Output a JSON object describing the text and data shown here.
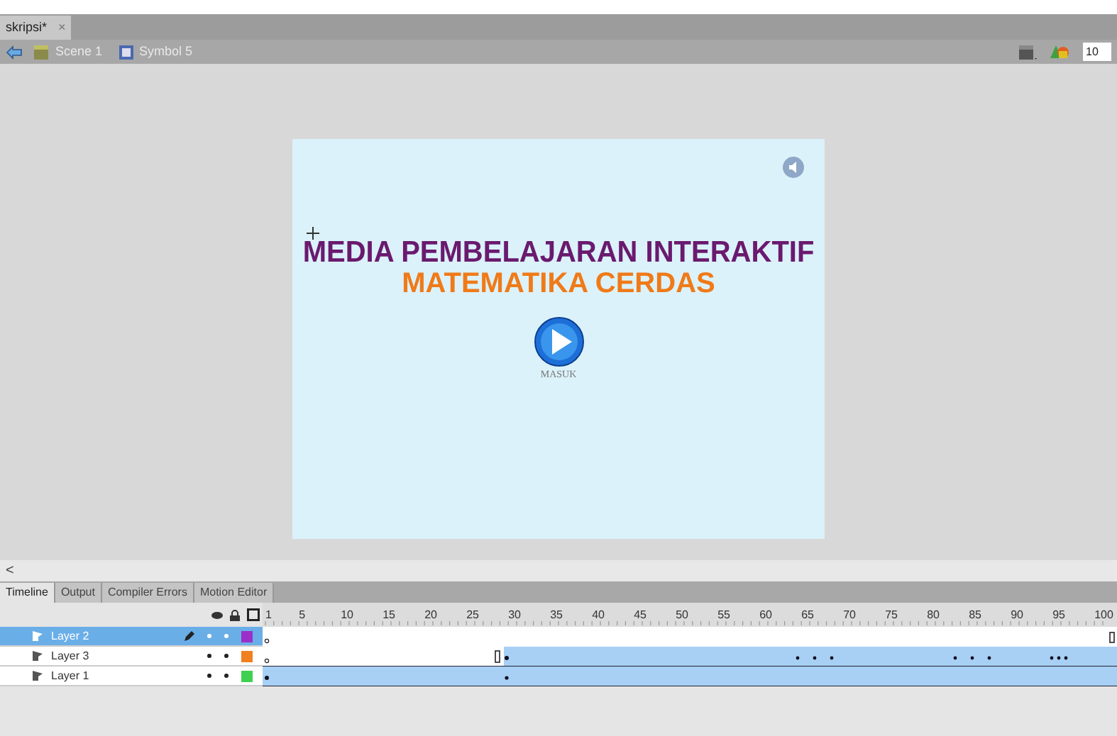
{
  "document_tab": {
    "label": "skripsi*",
    "close": "×"
  },
  "breadcrumb": {
    "items": [
      "Scene 1",
      "Symbol 5"
    ],
    "zoom": "10"
  },
  "stage": {
    "title": "MEDIA PEMBELAJARAN INTERAKTIF",
    "subtitle": "MATEMATIKA CERDAS",
    "button_label": "MASUK"
  },
  "scroll_arrow": "<",
  "panel_tabs": [
    {
      "label": "Timeline",
      "selected": true
    },
    {
      "label": "Output",
      "selected": false
    },
    {
      "label": "Compiler Errors",
      "selected": false
    },
    {
      "label": "Motion Editor",
      "selected": false
    }
  ],
  "timeline": {
    "ruler": [
      "1",
      "5",
      "10",
      "15",
      "20",
      "25",
      "30",
      "35",
      "40",
      "45",
      "50",
      "55",
      "60",
      "65",
      "70",
      "75",
      "80",
      "85",
      "90",
      "95",
      "100"
    ],
    "layers": [
      {
        "name": "Layer 2",
        "selected": true,
        "color": "#9b30c8"
      },
      {
        "name": "Layer 3",
        "selected": false,
        "color": "#f08020"
      },
      {
        "name": "Layer 1",
        "selected": false,
        "color": "#40d050"
      }
    ]
  }
}
